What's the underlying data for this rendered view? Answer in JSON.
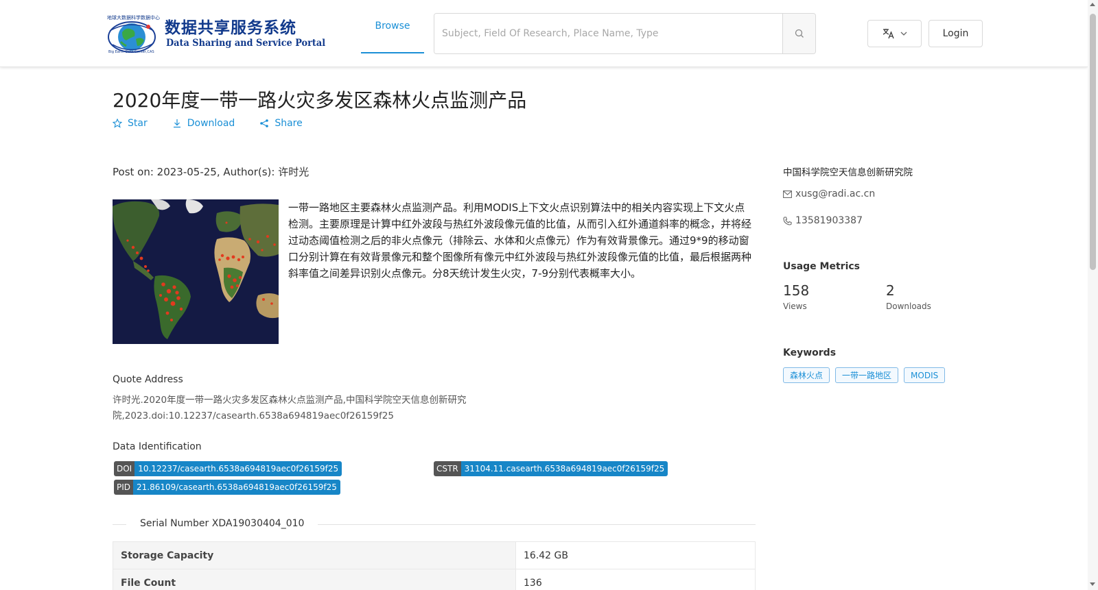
{
  "header": {
    "logo_micro_top": "地球大数据科学数据中心",
    "logo_cn": "数据共享服务系统",
    "logo_en": "Data Sharing and Service Portal",
    "logo_micro_bottom": "Big Earth Data Center,CAS",
    "nav_browse": "Browse",
    "search_placeholder": "Subject, Field Of Research, Place Name, Type",
    "search_value": "",
    "login_label": "Login",
    "lang_icon": "translate-icon"
  },
  "dataset": {
    "title": "2020年度一带一路火灾多发区森林火点监测产品",
    "actions": {
      "star": "Star",
      "download": "Download",
      "share": "Share"
    },
    "post_on": "Post on: 2023-05-25, Author(s): 许时光",
    "description": "一带一路地区主要森林火点监测产品。利用MODIS上下文火点识别算法中的相关内容实现上下文火点检测。主要原理是计算中红外波段与热红外波段像元值的比值，从而引入红外通道斜率的概念，并将经过动态阈值检测之后的非火点像元（排除云、水体和火点像元）作为有效背景像元。通过9*9的移动窗口分别计算在有效背景像元和整个图像所有像元中红外波段与热红外波段像元值的比值，最后根据两种斜率值之间差异识别火点像元。分8天统计发生火灾，7-9分别代表概率大小。",
    "quote_label": "Quote Address",
    "quote_text": "许时光.2020年度一带一路火灾多发区森林火点监测产品,中国科学院空天信息创新研究院,2023.doi:10.12237/casearth.6538a694819aec0f26159f25",
    "identification_label": "Data Identification",
    "identifiers": [
      {
        "key": "DOI",
        "value": "10.12237/casearth.6538a694819aec0f26159f25"
      },
      {
        "key": "CSTR",
        "value": "31104.11.casearth.6538a694819aec0f26159f25"
      },
      {
        "key": "PID",
        "value": "21.86109/casearth.6538a694819aec0f26159f25"
      }
    ],
    "serial_number": "Serial Number XDA19030404_010",
    "table": [
      {
        "key": "Storage Capacity",
        "value": "16.42 GB"
      },
      {
        "key": "File Count",
        "value": "136"
      }
    ]
  },
  "sidebar": {
    "org": "中国科学院空天信息创新研究院",
    "email": "xusg@radi.ac.cn",
    "phone": "13581903387",
    "metrics_title": "Usage Metrics",
    "views_count": "158",
    "views_label": "Views",
    "downloads_count": "2",
    "downloads_label": "Downloads",
    "keywords_title": "Keywords",
    "keywords": [
      "森林火点",
      "一带一路地区",
      "MODIS"
    ]
  },
  "colors": {
    "accent": "#1a8fd6",
    "badge_value": "#1786c7",
    "badge_key": "#555555"
  }
}
